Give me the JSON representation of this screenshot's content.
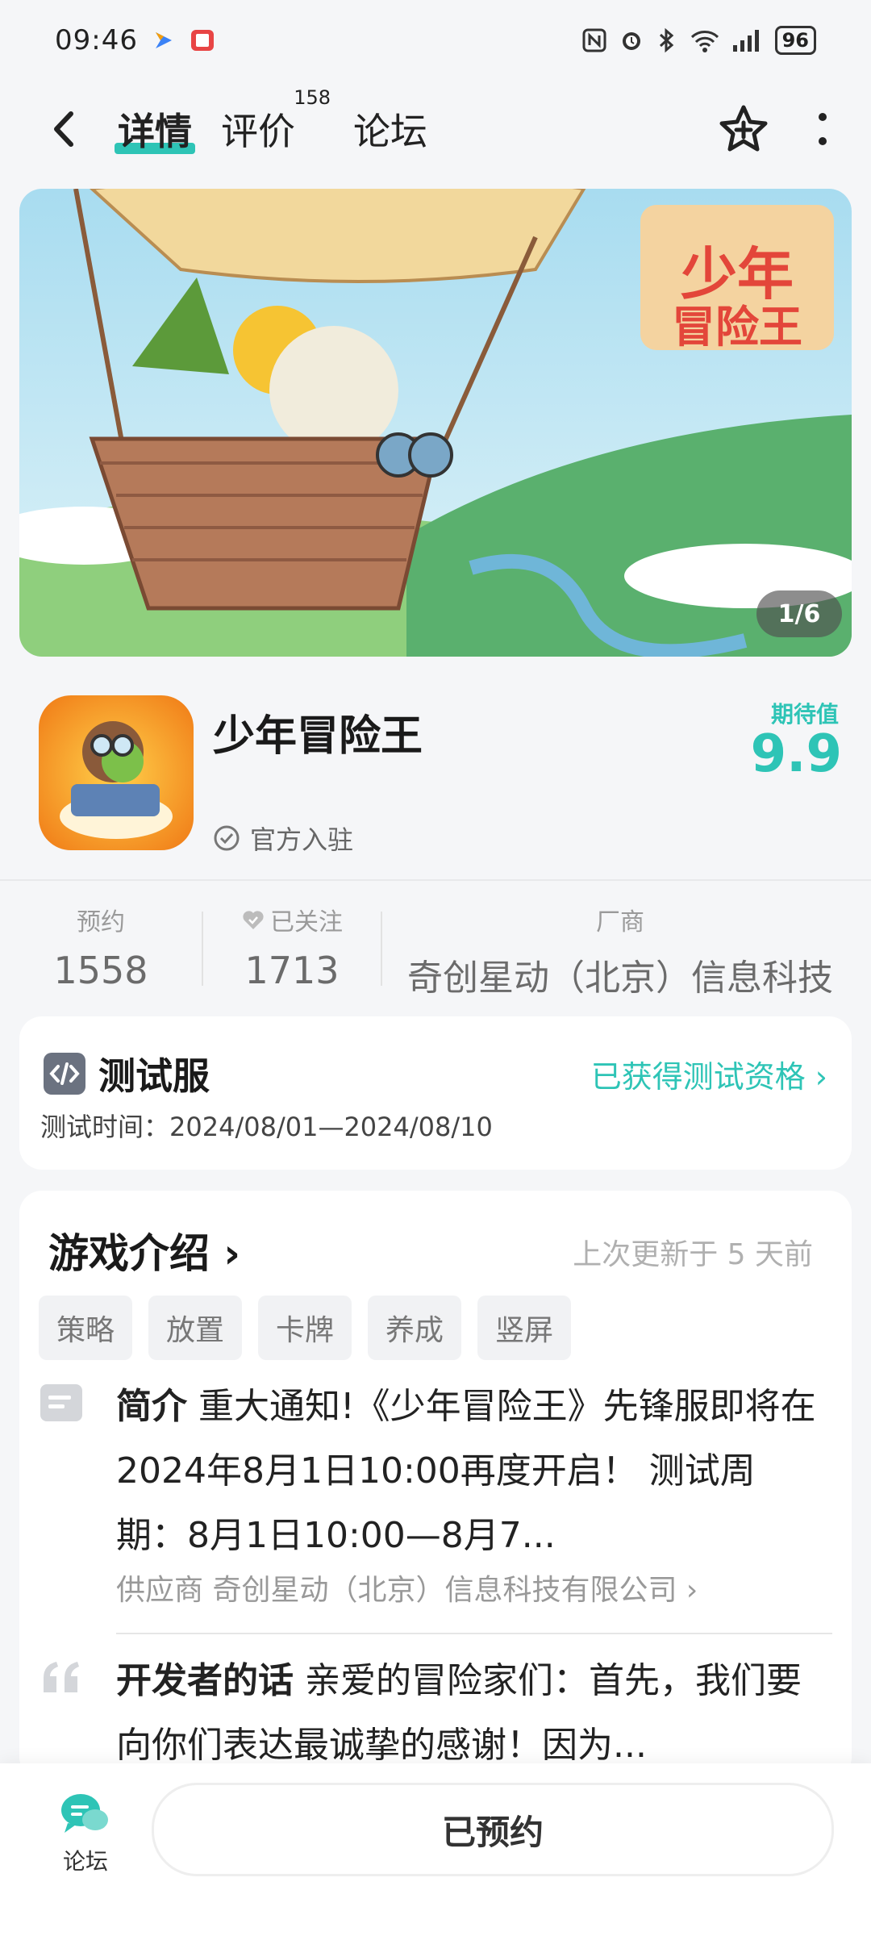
{
  "status_bar": {
    "time": "09:46",
    "battery": "96",
    "icons": [
      "nfc-icon",
      "alarm-icon",
      "bluetooth-icon",
      "wifi-icon",
      "signal-icon"
    ]
  },
  "nav": {
    "tabs": [
      {
        "label": "详情",
        "active": true
      },
      {
        "label": "评价",
        "count": "158"
      },
      {
        "label": "论坛"
      }
    ]
  },
  "banner": {
    "counter": "1/6",
    "logo_text": "少年冒险王"
  },
  "app": {
    "name": "少年冒险王",
    "official": "官方入驻",
    "expect_label": "期待值",
    "expect_value": "9.9"
  },
  "stats": {
    "reserve_label": "预约",
    "reserve_value": "1558",
    "follow_label": "已关注",
    "follow_value": "1713",
    "vendor_label": "厂商",
    "vendor_value": "奇创星动（北京）信息科技"
  },
  "test_server": {
    "title": "测试服",
    "link": "已获得测试资格",
    "time": "测试时间：2024/08/01—2024/08/10"
  },
  "intro": {
    "heading": "游戏介绍",
    "updated": "上次更新于 5 天前",
    "tags": [
      "策略",
      "放置",
      "卡牌",
      "养成",
      "竖屏"
    ],
    "summary_label": "简介",
    "summary_text": "重大通知!《少年冒险王》先锋服即将在2024年8月1日10:00再度开启！ 测试周期：8月1日10:00—8月7...",
    "supplier": "供应商 奇创星动（北京）信息科技有限公司",
    "dev_label": "开发者的话",
    "dev_text": "亲爱的冒险家们：首先，我们要向你们表达最诚挚的感谢！因为..."
  },
  "bottom": {
    "forum_label": "论坛",
    "reserved_label": "已预约"
  },
  "colors": {
    "accent": "#2ec4b6",
    "background": "#f5f6f8"
  }
}
